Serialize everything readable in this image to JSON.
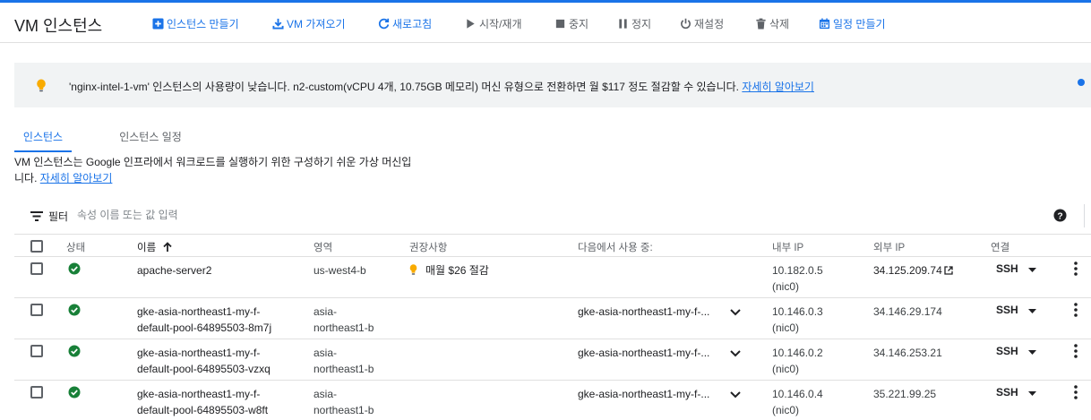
{
  "page_title": "VM 인스턴스",
  "toolbar": {
    "create_instance": "인스턴스 만들기",
    "import_vm": "VM 가져오기",
    "refresh": "새로고침",
    "start_resume": "시작/재개",
    "stop": "중지",
    "suspend": "정지",
    "reset": "재설정",
    "delete": "삭제",
    "create_schedule": "일정 만들기"
  },
  "banner": {
    "message": "'nginx-intel-1-vm' 인스턴스의 사용량이 낮습니다. n2-custom(vCPU 4개, 10.75GB 메모리) 머신 유형으로 전환하면 월 $117 정도 절감할 수 있습니다.",
    "link": "자세히 알아보기"
  },
  "tabs": [
    "인스턴스",
    "인스턴스 일정"
  ],
  "description": {
    "line1": "VM 인스턴스는 Google 인프라에서 워크로드를 실행하기 위한 구성하기 쉬운 가상 머신입",
    "line2": "니다.",
    "link": "자세히 알아보기"
  },
  "filter": {
    "label": "필터",
    "placeholder": "속성 이름 또는 값 입력"
  },
  "table": {
    "headers": {
      "status": "상태",
      "name": "이름",
      "zone": "영역",
      "recommendation": "권장사항",
      "in_use_by": "다음에서 사용 중:",
      "internal_ip": "내부 IP",
      "external_ip": "외부 IP",
      "connect": "연결"
    },
    "rows": [
      {
        "name_line1": "apache-server2",
        "name_line2": "",
        "zone_line1": "us-west4-b",
        "zone_line2": "",
        "recommendation": "매월 $26 절감",
        "in_use_by": "",
        "internal_ip": "10.182.0.5",
        "nic": "(nic0)",
        "external_ip": "34.125.209.74",
        "connect": "SSH"
      },
      {
        "name_line1": "gke-asia-northeast1-my-f-",
        "name_line2": "default-pool-64895503-8m7j",
        "zone_line1": "asia-",
        "zone_line2": "northeast1-b",
        "recommendation": "",
        "in_use_by": "gke-asia-northeast1-my-f-...",
        "internal_ip": "10.146.0.3",
        "nic": "(nic0)",
        "external_ip": "34.146.29.174",
        "connect": "SSH"
      },
      {
        "name_line1": "gke-asia-northeast1-my-f-",
        "name_line2": "default-pool-64895503-vzxq",
        "zone_line1": "asia-",
        "zone_line2": "northeast1-b",
        "recommendation": "",
        "in_use_by": "gke-asia-northeast1-my-f-...",
        "internal_ip": "10.146.0.2",
        "nic": "(nic0)",
        "external_ip": "34.146.253.21",
        "connect": "SSH"
      },
      {
        "name_line1": "gke-asia-northeast1-my-f-",
        "name_line2": "default-pool-64895503-w8ft",
        "zone_line1": "asia-",
        "zone_line2": "northeast1-b",
        "recommendation": "",
        "in_use_by": "gke-asia-northeast1-my-f-...",
        "internal_ip": "10.146.0.4",
        "nic": "(nic0)",
        "external_ip": "35.221.99.25",
        "connect": "SSH"
      }
    ]
  },
  "colors": {
    "accent": "#1a73e8",
    "status_running": "#188038",
    "bulb": "#f9ab00"
  }
}
